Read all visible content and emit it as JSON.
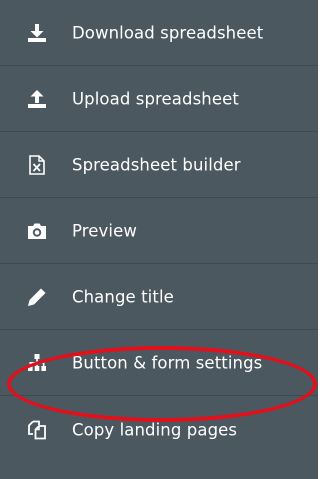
{
  "menu": {
    "items": [
      {
        "label": "Download spreadsheet",
        "icon": "download-icon"
      },
      {
        "label": "Upload spreadsheet",
        "icon": "upload-icon"
      },
      {
        "label": "Spreadsheet builder",
        "icon": "spreadsheet-file-icon"
      },
      {
        "label": "Preview",
        "icon": "camera-icon"
      },
      {
        "label": "Change title",
        "icon": "pencil-icon"
      },
      {
        "label": "Button & form settings",
        "icon": "sitemap-icon"
      },
      {
        "label": "Copy landing pages",
        "icon": "copy-icon"
      }
    ]
  },
  "colors": {
    "menu_background": "#4c5860",
    "divider": "#3f4950",
    "text": "#ffffff",
    "highlight_ring": "#e3101b"
  }
}
